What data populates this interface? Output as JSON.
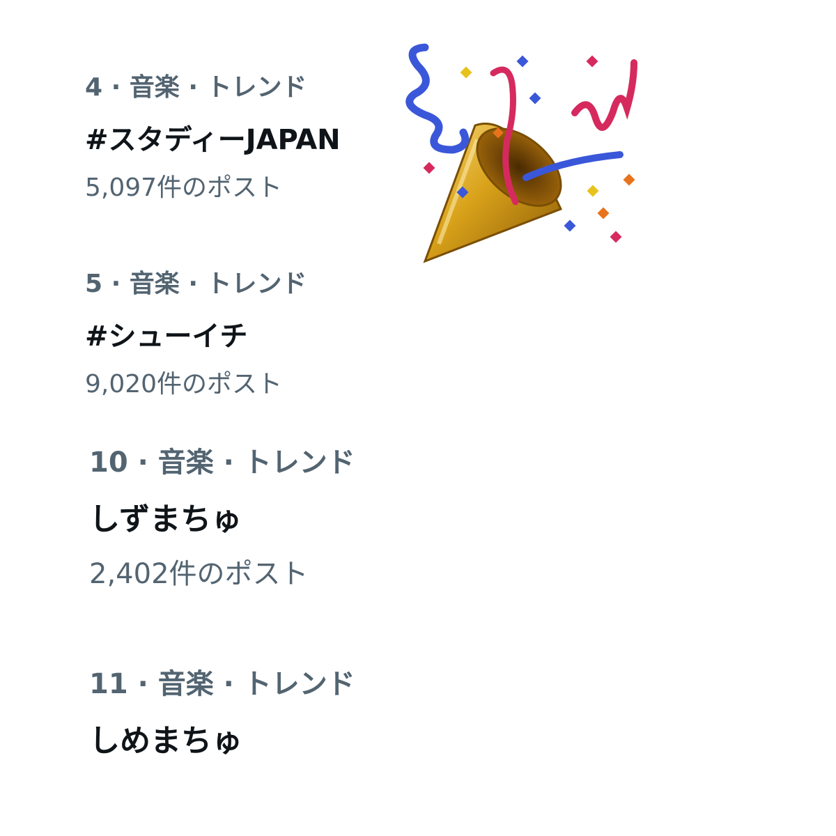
{
  "trends": [
    {
      "meta": "4 · 音楽 · トレンド",
      "name": "#スタディーJAPAN",
      "count": "5,097件のポスト"
    },
    {
      "meta": "5 · 音楽 · トレンド",
      "name": "#シューイチ",
      "count": "9,020件のポスト"
    },
    {
      "meta": "10 · 音楽 · トレンド",
      "name": "しずまちゅ",
      "count": "2,402件のポスト"
    },
    {
      "meta": "11 · 音楽 · トレンド",
      "name": "しめまちゅ"
    }
  ],
  "decoration": {
    "icon": "party-popper-icon",
    "colors": {
      "cone": "#d9a21a",
      "blue": "#3b57d9",
      "pink": "#d62a5f",
      "yellow": "#e8c21c",
      "orange": "#e8731c"
    }
  }
}
